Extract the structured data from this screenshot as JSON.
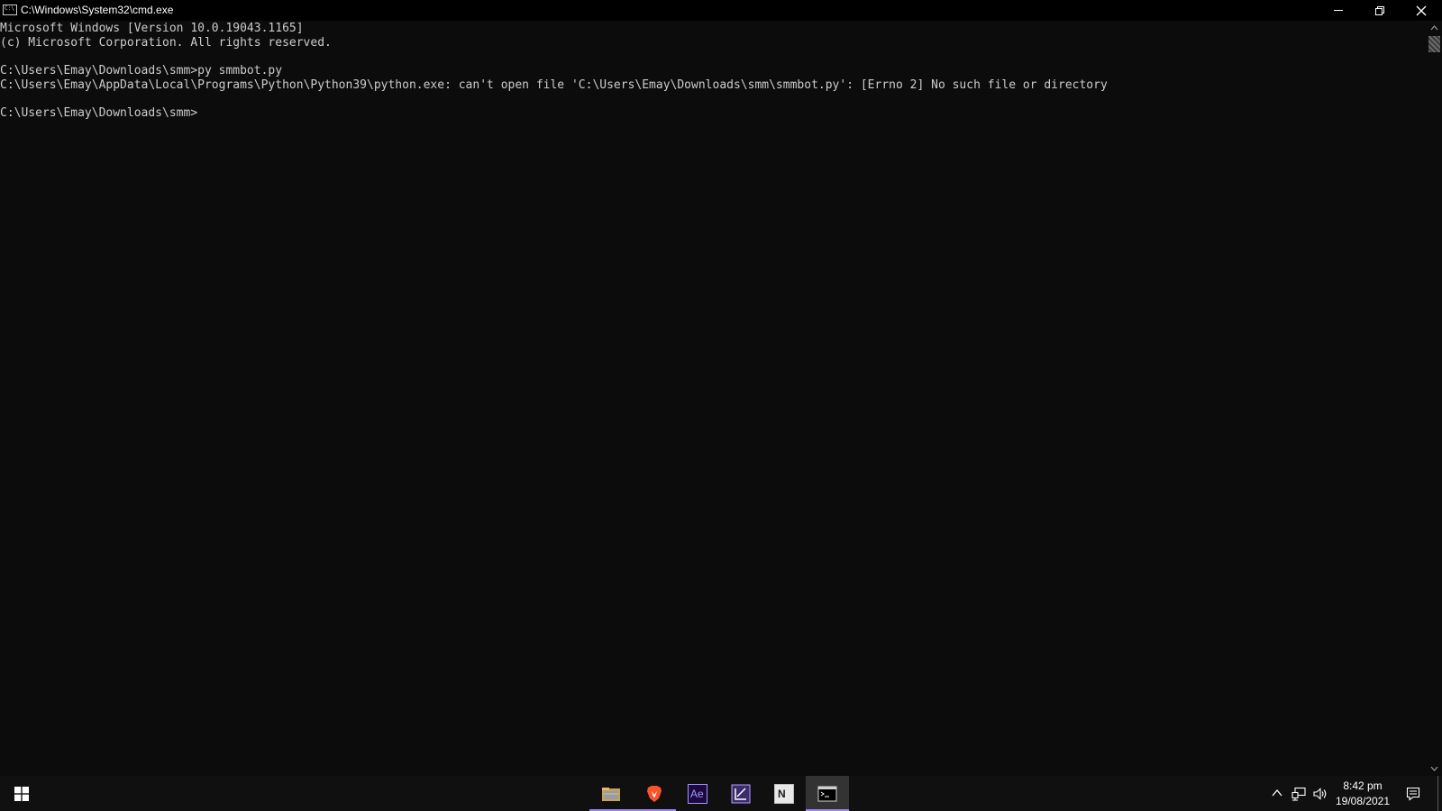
{
  "window": {
    "title": "C:\\Windows\\System32\\cmd.exe",
    "icon": "cmd-window-icon",
    "cmd_icon_glyph": "C:\\"
  },
  "controls": {
    "minimize": "minimize-icon",
    "maximize": "restore-icon",
    "close": "close-icon"
  },
  "console": {
    "background": "#0c0c0c",
    "foreground": "#cccccc",
    "lines": [
      "Microsoft Windows [Version 10.0.19043.1165]",
      "(c) Microsoft Corporation. All rights reserved.",
      "",
      "C:\\Users\\Emay\\Downloads\\smm>py smmbot.py",
      "C:\\Users\\Emay\\AppData\\Local\\Programs\\Python\\Python39\\python.exe: can't open file 'C:\\Users\\Emay\\Downloads\\smm\\smmbot.py': [Errno 2] No such file or directory",
      "",
      "C:\\Users\\Emay\\Downloads\\smm>"
    ]
  },
  "taskbar": {
    "apps": [
      {
        "name": "file-explorer",
        "icon": "folder-icon",
        "active": false,
        "running": true
      },
      {
        "name": "brave-browser",
        "icon": "brave-lion-icon",
        "active": false,
        "running": true
      },
      {
        "name": "after-effects",
        "icon": "after-effects-icon",
        "label": "Ae",
        "active": false,
        "running": false
      },
      {
        "name": "visual-studio",
        "icon": "visual-studio-icon",
        "active": false,
        "running": false
      },
      {
        "name": "notepad-plus-plus",
        "icon": "notepad-icon",
        "label": "N",
        "active": false,
        "running": false
      },
      {
        "name": "command-prompt",
        "icon": "terminal-icon",
        "active": true,
        "running": true
      }
    ],
    "accent": "#9a86e8",
    "tray": {
      "chevron": "chevron-up-icon",
      "network": "network-icon",
      "volume": "volume-icon",
      "time": "8:42 pm",
      "date": "19/08/2021",
      "notifications": "action-center-icon"
    }
  }
}
